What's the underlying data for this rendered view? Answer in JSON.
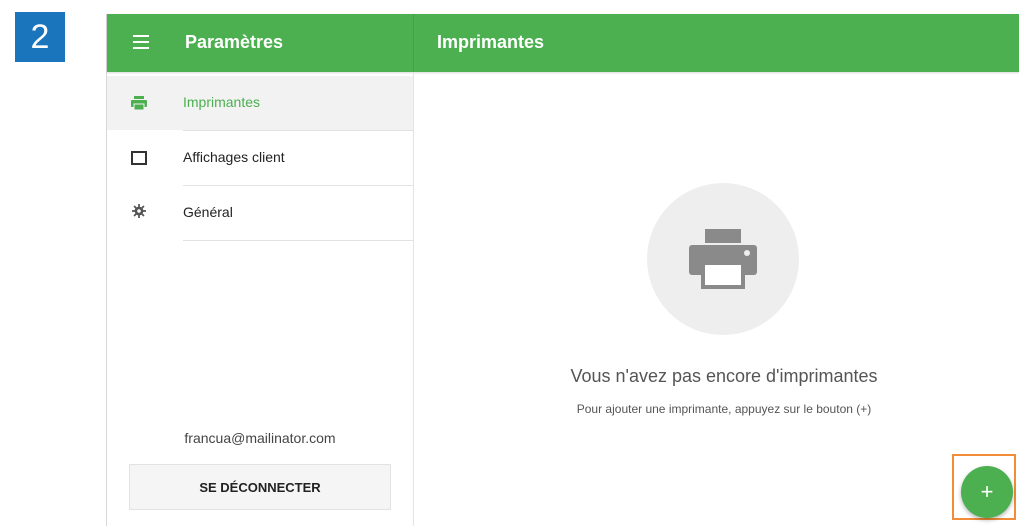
{
  "step_badge": "2",
  "header": {
    "left_title": "Paramètres",
    "right_title": "Imprimantes",
    "menu_icon": "hamburger-menu-icon",
    "accent_color": "#4caf50"
  },
  "sidebar": {
    "items": [
      {
        "label": "Imprimantes",
        "icon": "printer-icon",
        "active": true
      },
      {
        "label": "Affichages client",
        "icon": "display-icon",
        "active": false
      },
      {
        "label": "Général",
        "icon": "gear-icon",
        "active": false
      }
    ],
    "account_email": "francua@mailinator.com",
    "logout_label": "SE DÉCONNECTER"
  },
  "main": {
    "empty_icon": "printer-icon",
    "empty_title": "Vous n'avez pas encore d'imprimantes",
    "empty_hint": "Pour ajouter une imprimante, appuyez sur le bouton (+)"
  },
  "fab": {
    "label": "+",
    "icon": "plus-icon",
    "highlight_color": "#f28c38"
  }
}
